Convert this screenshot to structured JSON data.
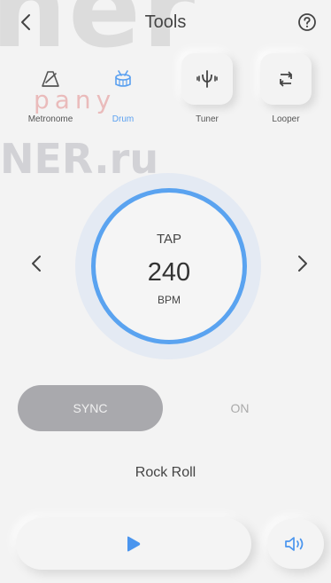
{
  "header": {
    "title": "Tools"
  },
  "watermark": {
    "big": "ner",
    "company": "pany",
    "domain": "NER.ru"
  },
  "tools": [
    {
      "label": "Metronome",
      "icon": "metronome-icon",
      "active": false
    },
    {
      "label": "Drum",
      "icon": "drum-icon",
      "active": true
    },
    {
      "label": "Tuner",
      "icon": "tuner-icon",
      "active": false
    },
    {
      "label": "Looper",
      "icon": "looper-icon",
      "active": false
    }
  ],
  "tempo": {
    "tap_label": "TAP",
    "bpm": "240",
    "unit": "BPM"
  },
  "sync": {
    "sync_label": "SYNC",
    "on_label": "ON"
  },
  "style": {
    "name": "Rock Roll"
  },
  "colors": {
    "accent": "#5aa3f0",
    "sync_pill": "#a9a9ad",
    "background": "#f3f3f3"
  }
}
